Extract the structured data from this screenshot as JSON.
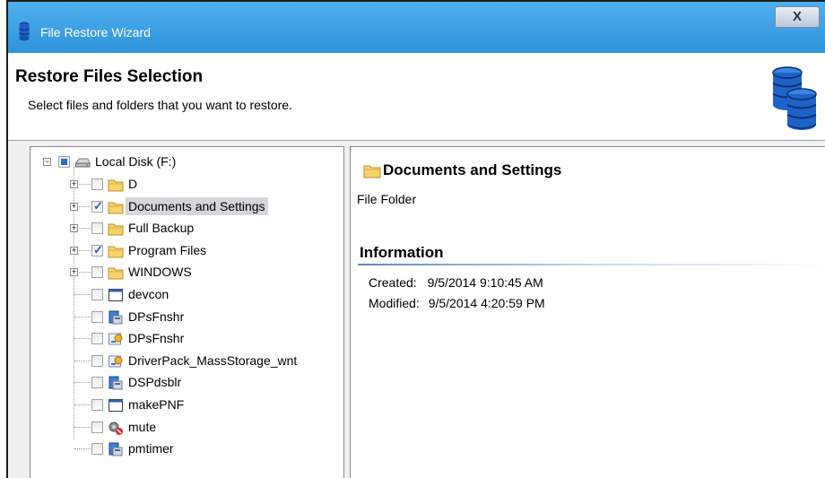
{
  "window": {
    "title": "File Restore Wizard",
    "close_glyph": "X"
  },
  "header": {
    "title": "Restore Files Selection",
    "subtitle": "Select files and folders that you want to restore."
  },
  "tree": {
    "root": {
      "label": "Local Disk (F:)",
      "check": "partial",
      "icon": "drive-icon"
    },
    "items": [
      {
        "label": "D",
        "icon": "folder-icon",
        "check": "unchecked",
        "expandable": true
      },
      {
        "label": "Documents and Settings",
        "icon": "folder-icon",
        "check": "checked",
        "expandable": true,
        "selected": true
      },
      {
        "label": "Full Backup",
        "icon": "folder-icon",
        "check": "unchecked",
        "expandable": true
      },
      {
        "label": "Program Files",
        "icon": "folder-icon",
        "check": "checked",
        "expandable": true
      },
      {
        "label": "WINDOWS",
        "icon": "folder-icon",
        "check": "unchecked",
        "expandable": true
      },
      {
        "label": "devcon",
        "icon": "window-app-icon",
        "check": "unchecked",
        "expandable": false
      },
      {
        "label": "DPsFnshr",
        "icon": "installer-icon",
        "check": "unchecked",
        "expandable": false
      },
      {
        "label": "DPsFnshr",
        "icon": "setup-package-icon",
        "check": "unchecked",
        "expandable": false
      },
      {
        "label": "DriverPack_MassStorage_wnt",
        "icon": "setup-package-icon",
        "check": "unchecked",
        "expandable": false
      },
      {
        "label": "DSPdsblr",
        "icon": "installer-icon",
        "check": "unchecked",
        "expandable": false
      },
      {
        "label": "makePNF",
        "icon": "window-app-icon",
        "check": "unchecked",
        "expandable": false
      },
      {
        "label": "mute",
        "icon": "mute-app-icon",
        "check": "unchecked",
        "expandable": false
      },
      {
        "label": "pmtimer",
        "icon": "installer-icon",
        "check": "unchecked",
        "expandable": false
      }
    ]
  },
  "details": {
    "name": "Documents and Settings",
    "type": "File Folder",
    "info_heading": "Information",
    "created_label": "Created:",
    "created_value": "9/5/2014 9:10:45 AM",
    "modified_label": "Modified:",
    "modified_value": "9/5/2014 4:20:59 PM"
  }
}
